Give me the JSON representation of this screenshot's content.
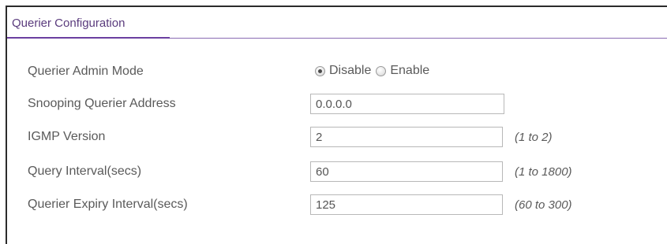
{
  "tab": {
    "title": "Querier Configuration"
  },
  "form": {
    "admin_mode": {
      "label": "Querier Admin Mode",
      "options": [
        "Disable",
        "Enable"
      ],
      "selected": "Disable"
    },
    "address": {
      "label": "Snooping Querier Address",
      "value": "0.0.0.0"
    },
    "igmp_version": {
      "label": "IGMP Version",
      "value": "2",
      "hint": "(1 to 2)"
    },
    "query_interval": {
      "label": "Query Interval(secs)",
      "value": "60",
      "hint": "(1 to 1800)"
    },
    "expiry_interval": {
      "label": "Querier Expiry Interval(secs)",
      "value": "125",
      "hint": "(60 to 300)"
    }
  }
}
